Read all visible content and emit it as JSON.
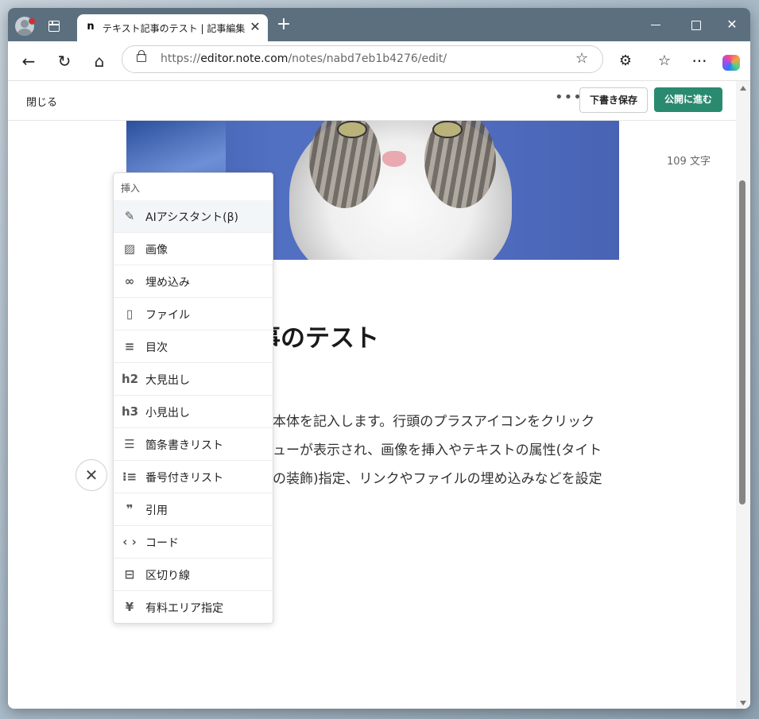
{
  "browser": {
    "tab": {
      "favicon": "n",
      "title": "テキスト記事のテスト | 記事編集 | note"
    },
    "url_prefix": "https://",
    "url_host": "editor.note.com",
    "url_path": "/notes/nabd7eb1b4276/edit/"
  },
  "editor": {
    "close_label": "閉じる",
    "more_label": "•••",
    "draft_label": "下書き保存",
    "publish_label": "公開に進む",
    "word_count": "109 文字",
    "heading_visible": "事のテスト",
    "body_lines": [
      "本体を記入します。行頭のプラスアイコンをクリック",
      "ューが表示され、画像を挿入やテキストの属性(タイト",
      "の装飾)指定、リンクやファイルの埋め込みなどを設定"
    ]
  },
  "insert_menu": {
    "title": "挿入",
    "items": [
      {
        "label": "AIアシスタント(β)",
        "icon": "wand-icon"
      },
      {
        "label": "画像",
        "icon": "image-icon"
      },
      {
        "label": "埋め込み",
        "icon": "link-icon"
      },
      {
        "label": "ファイル",
        "icon": "file-icon"
      },
      {
        "label": "目次",
        "icon": "toc-icon"
      },
      {
        "label": "大見出し",
        "icon": "h2"
      },
      {
        "label": "小見出し",
        "icon": "h3"
      },
      {
        "label": "箇条書きリスト",
        "icon": "bullet-list-icon"
      },
      {
        "label": "番号付きリスト",
        "icon": "numbered-list-icon"
      },
      {
        "label": "引用",
        "icon": "quote-icon"
      },
      {
        "label": "コード",
        "icon": "code-icon"
      },
      {
        "label": "区切り線",
        "icon": "divider-icon"
      },
      {
        "label": "有料エリア指定",
        "icon": "yen-icon"
      }
    ]
  }
}
